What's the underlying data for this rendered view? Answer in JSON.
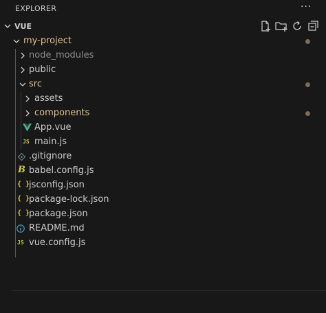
{
  "header": {
    "title": "EXPLORER",
    "more": "···"
  },
  "section": {
    "title": "VUE"
  },
  "tree": {
    "root": {
      "label": "my-project"
    },
    "items": [
      {
        "label": "node_modules"
      },
      {
        "label": "public"
      },
      {
        "label": "src"
      },
      {
        "label": "assets"
      },
      {
        "label": "components"
      },
      {
        "label": "App.vue"
      },
      {
        "label": "main.js"
      },
      {
        "label": ".gitignore"
      },
      {
        "label": "babel.config.js"
      },
      {
        "label": "jsconfig.json"
      },
      {
        "label": "package-lock.json"
      },
      {
        "label": "package.json"
      },
      {
        "label": "README.md"
      },
      {
        "label": "vue.config.js"
      }
    ]
  },
  "icons": {
    "js": "JS",
    "json": "{ }",
    "vue_color": "#41b883",
    "js_color": "#cbcb41",
    "json_color": "#cbcb41",
    "info_color": "#519aba",
    "modified_color": "#e2c08d",
    "dim_color": "#8c8c8c",
    "folder_text_color": "#cccccc",
    "dot_color": "#7f6a57"
  }
}
